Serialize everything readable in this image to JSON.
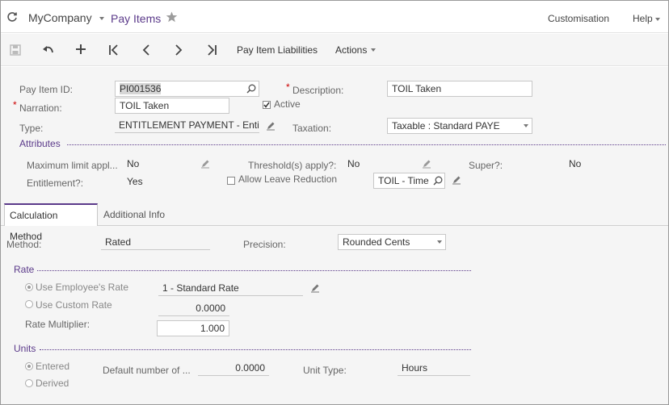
{
  "header": {
    "company": "MyCompany",
    "screen_title": "Pay Items",
    "customisation": "Customisation",
    "help": "Help"
  },
  "toolbar": {
    "pay_item_liabilities": "Pay Item Liabilities",
    "actions": "Actions"
  },
  "form": {
    "pay_item_id_label": "Pay Item ID:",
    "pay_item_id_value": "PI001536",
    "description_label": "Description:",
    "description_value": "TOIL Taken",
    "narration_label": "Narration:",
    "narration_value": "TOIL Taken",
    "active_label": "Active",
    "type_label": "Type:",
    "type_value": "ENTITLEMENT PAYMENT - Enti",
    "taxation_label": "Taxation:",
    "taxation_value": "Taxable : Standard PAYE"
  },
  "attributes": {
    "title": "Attributes",
    "max_limit_label": "Maximum limit appl...",
    "max_limit_value": "No",
    "threshold_label": "Threshold(s) apply?:",
    "threshold_value": "No",
    "super_label": "Super?:",
    "super_value": "No",
    "entitlement_label": "Entitlement?:",
    "entitlement_value": "Yes",
    "allow_leave_label": "Allow Leave Reduction",
    "toil_value": "TOIL - Time"
  },
  "tabs": [
    {
      "label": "Calculation Method"
    },
    {
      "label": "Additional Info"
    }
  ],
  "calc": {
    "method_label": "Method:",
    "method_value": "Rated",
    "precision_label": "Precision:",
    "precision_value": "Rounded Cents",
    "rate_title": "Rate",
    "use_employee_rate": "Use Employee's Rate",
    "employee_rate_value": "1 - Standard Rate",
    "use_custom_rate": "Use Custom Rate",
    "custom_rate_value": "0.0000",
    "rate_multiplier_label": "Rate Multiplier:",
    "rate_multiplier_value": "1.000",
    "units_title": "Units",
    "entered_label": "Entered",
    "derived_label": "Derived",
    "default_number_label": "Default number of ...",
    "default_number_value": "0.0000",
    "unit_type_label": "Unit Type:",
    "unit_type_value": "Hours"
  },
  "colors": {
    "accent": "#5b3a8a",
    "required": "#cc0000"
  }
}
